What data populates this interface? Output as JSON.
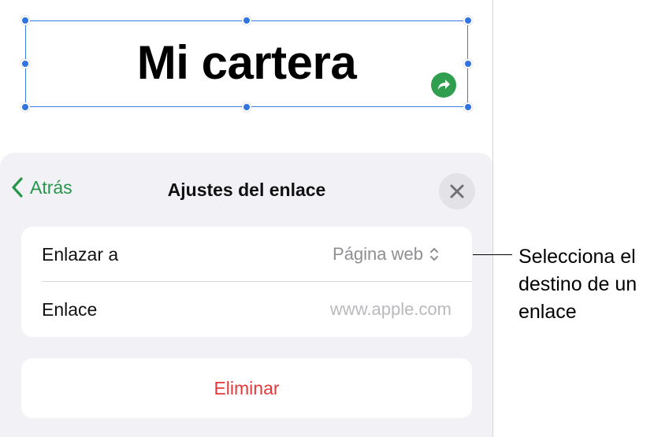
{
  "canvas": {
    "text_box_title": "Mi cartera",
    "link_badge_icon": "link-arrow-icon",
    "accent_color": "#2f74e0"
  },
  "sheet": {
    "back_label": "Atrás",
    "title": "Ajustes del enlace",
    "close_icon": "close-icon",
    "settings": {
      "link_to_label": "Enlazar a",
      "link_to_value": "Página web",
      "link_label": "Enlace",
      "link_placeholder": "www.apple.com"
    },
    "delete_label": "Eliminar",
    "accent_green": "#27964a",
    "delete_red": "#e5383b"
  },
  "callout": {
    "line1": "Selecciona el",
    "line2": "destino de un",
    "line3": "enlace"
  }
}
